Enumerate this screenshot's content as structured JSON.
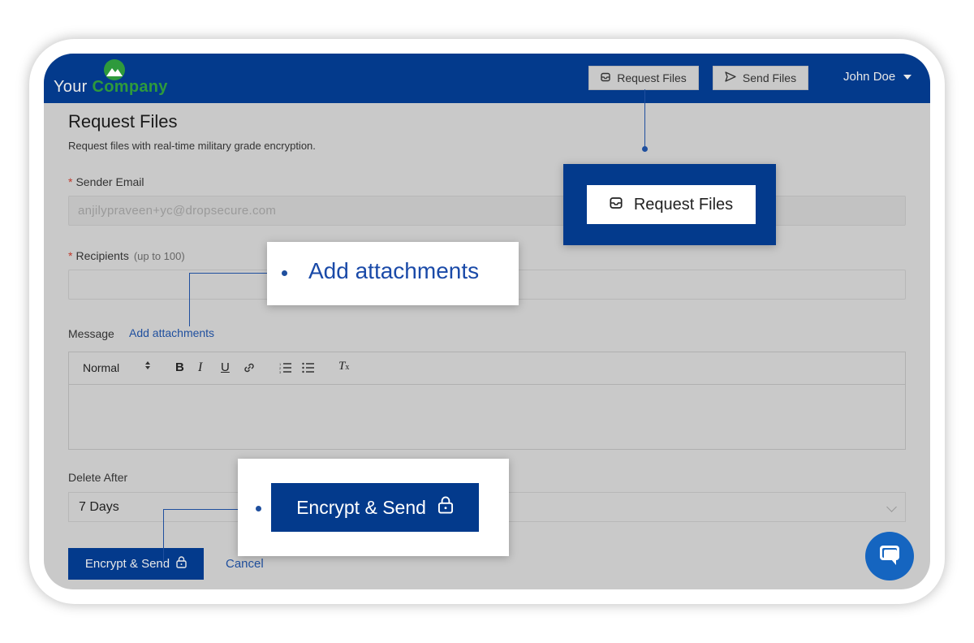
{
  "app": {
    "logo_prefix": "Your",
    "logo_accent": "Company",
    "brand_color": "#033a8c",
    "accent_color": "#2e9a3c"
  },
  "nav": {
    "request_files": "Request Files",
    "send_files": "Send Files",
    "user_name": "John Doe"
  },
  "page": {
    "title": "Request Files",
    "subtitle": "Request files with real-time military grade encryption."
  },
  "form": {
    "sender_email_label": "Sender Email",
    "sender_email_value": "anjilypraveen+yc@dropsecure.com",
    "recipients_label": "Recipients",
    "recipients_hint": "(up to 100)",
    "recipients_value": "",
    "message_label": "Message",
    "add_attachments": "Add attachments",
    "editor_format": "Normal",
    "editor_tools": [
      "bold-icon",
      "italic-icon",
      "underline-icon",
      "link-icon",
      "ordered-list-icon",
      "bullet-list-icon",
      "clear-format-icon"
    ],
    "delete_after_label": "Delete After",
    "delete_after_value": "7 Days",
    "send_button": "Encrypt & Send",
    "cancel_button": "Cancel"
  },
  "callouts": {
    "request_files": "Request Files",
    "add_attachments": "Add attachments",
    "encrypt_send": "Encrypt & Send"
  }
}
